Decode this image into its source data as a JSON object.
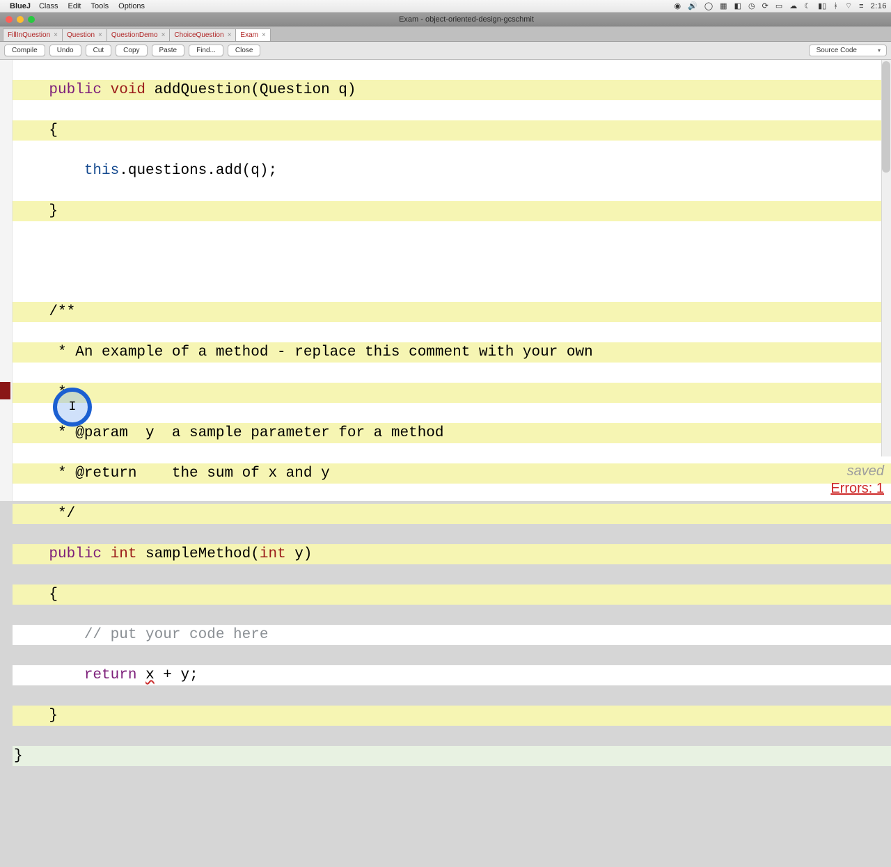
{
  "menubar": {
    "app": "BlueJ",
    "items": [
      "Class",
      "Edit",
      "Tools",
      "Options"
    ],
    "clock": "2:16"
  },
  "window": {
    "title": "Exam - object-oriented-design-gcschmit"
  },
  "tabs": [
    {
      "label": "FillInQuestion"
    },
    {
      "label": "Question"
    },
    {
      "label": "QuestionDemo"
    },
    {
      "label": "ChoiceQuestion"
    },
    {
      "label": "Exam"
    }
  ],
  "toolbar": {
    "compile": "Compile",
    "undo": "Undo",
    "cut": "Cut",
    "copy": "Copy",
    "paste": "Paste",
    "find": "Find...",
    "close": "Close",
    "view_mode": "Source Code"
  },
  "code": {
    "l1p1": "    public ",
    "l1p2": "void",
    "l1p3": " addQuestion(Question q)",
    "l2": "    {",
    "l3p1": "        ",
    "l3p2": "this",
    "l3p3": ".questions.add(q);",
    "l4": "    }",
    "l5": "",
    "l6": "",
    "l7": "",
    "l8": "    /**",
    "l9": "     * An example of a method - replace this comment with your own",
    "l10": "     *",
    "l11": "     * @param  y  a sample parameter for a method",
    "l12": "     * @return    the sum of x and y",
    "l13": "     */",
    "l14p1": "    public ",
    "l14p2": "int",
    "l14p3": " sampleMethod(",
    "l14p4": "int",
    "l14p5": " y)",
    "l15": "    {",
    "l16": "        // put your code here",
    "l17p1": "        ",
    "l17p2": "return",
    "l17p3": " ",
    "l17err": "x",
    "l17p4": " + y;",
    "l18": "    }",
    "l19": "}"
  },
  "status": {
    "saved": "saved",
    "errors": "Errors: 1"
  }
}
